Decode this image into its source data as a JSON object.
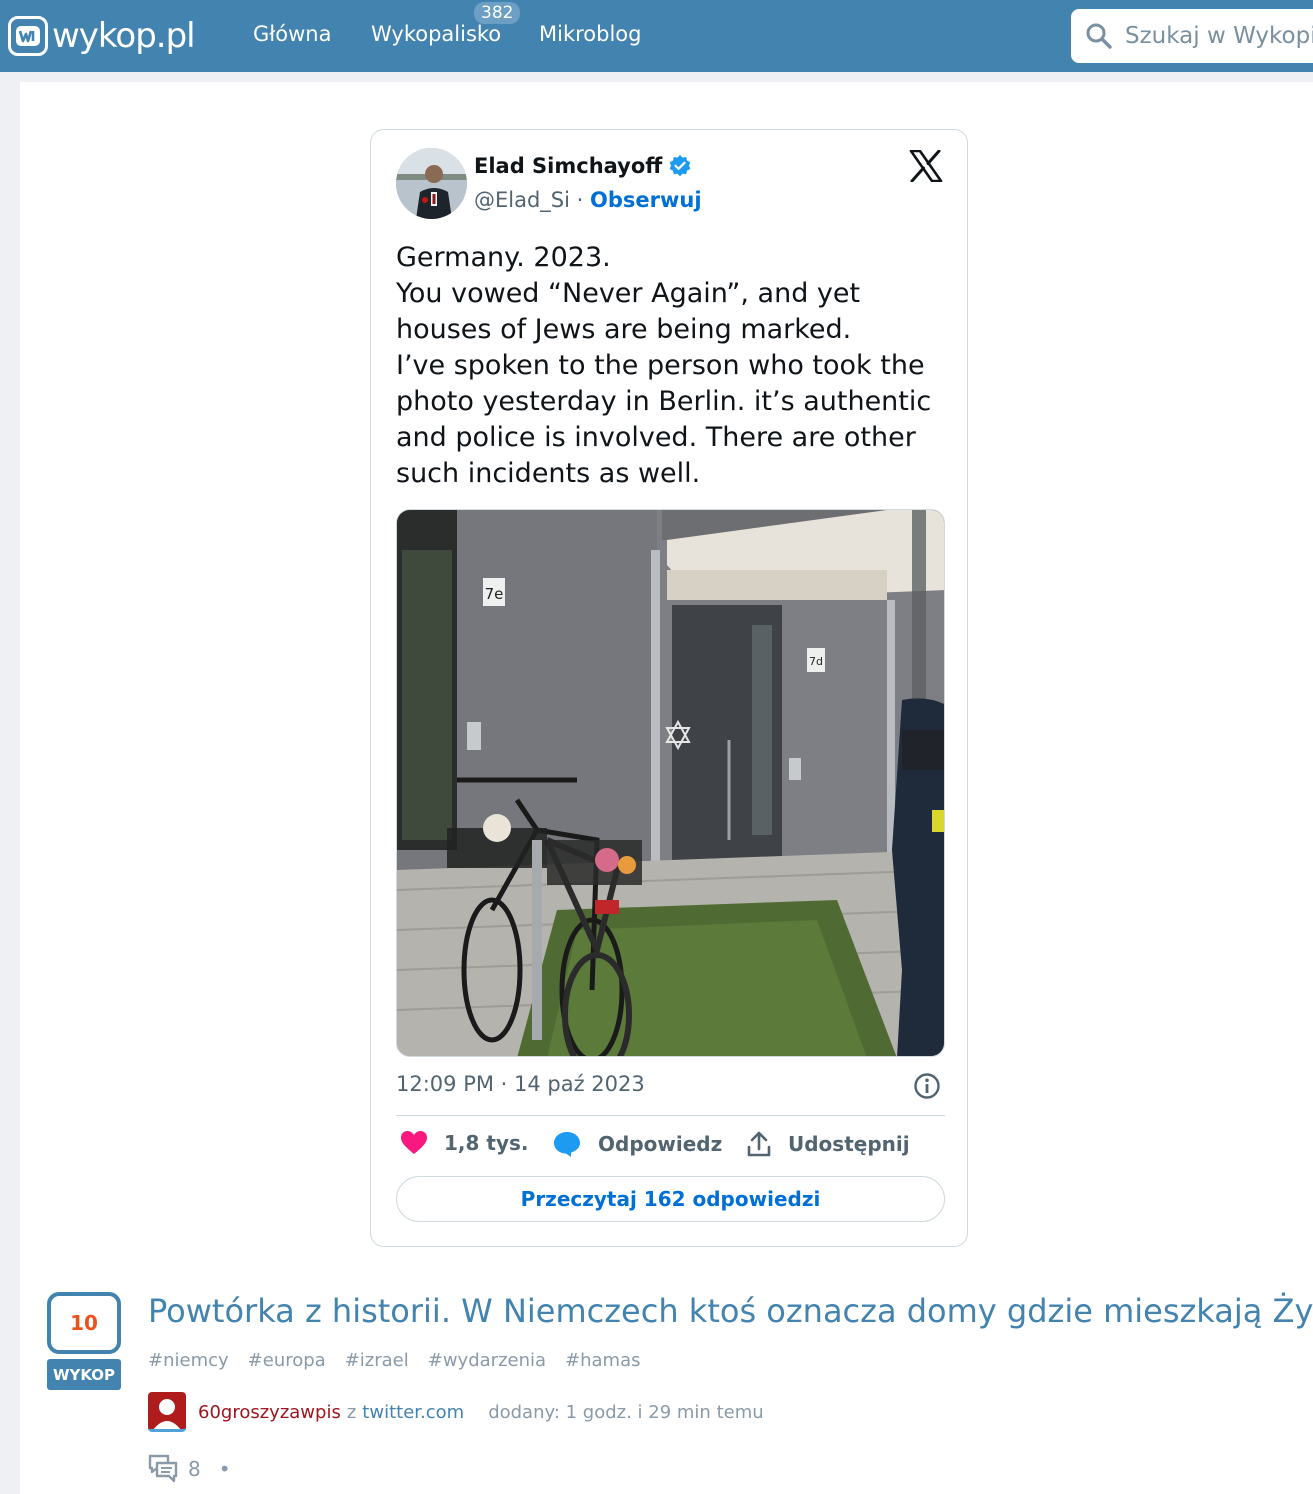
{
  "header": {
    "logo_text": "wykop.pl",
    "nav": [
      {
        "label": "Główna"
      },
      {
        "label": "Wykopalisko",
        "badge": "382"
      },
      {
        "label": "Mikroblog"
      }
    ],
    "search_placeholder": "Szukaj w Wykopie"
  },
  "tweet": {
    "author_name": "Elad Simchayoff",
    "handle": "@Elad_Si",
    "separator": " · ",
    "follow_label": "Obserwuj",
    "text_lines": [
      "Germany. 2023.",
      "You vowed “Never Again”, and yet",
      "houses of Jews are being marked.",
      "I’ve spoken to the person who took the",
      "photo yesterday in Berlin. it’s authentic",
      "and police is involved. There are other",
      "such incidents as well."
    ],
    "timestamp": "12:09 PM · 14 paź 2023",
    "likes": "1,8 tys.",
    "reply_label": "Odpowiedz",
    "share_label": "Udostępnij",
    "read_replies_label": "Przeczytaj 162 odpowiedzi",
    "photo_signs": [
      "7e",
      "7d"
    ]
  },
  "entry": {
    "votes": "10",
    "vote_button": "WYKOP",
    "title": "Powtórka z historii. W Niemczech ktoś oznacza domy gdzie mieszkają Żydzi",
    "tags": [
      "#niemcy",
      "#europa",
      "#izrael",
      "#wydarzenia",
      "#hamas"
    ],
    "username": "60groszyzawpis",
    "from_word": "z",
    "domain": "twitter.com",
    "added": "dodany: 1 godz. i 29 min temu",
    "comments_count": "8",
    "bullet": "•"
  },
  "colors": {
    "brand": "#4383af",
    "vote_count": "#e8531c",
    "username": "#a0141e",
    "twitter_link": "#006fd6",
    "like": "#f91880"
  }
}
